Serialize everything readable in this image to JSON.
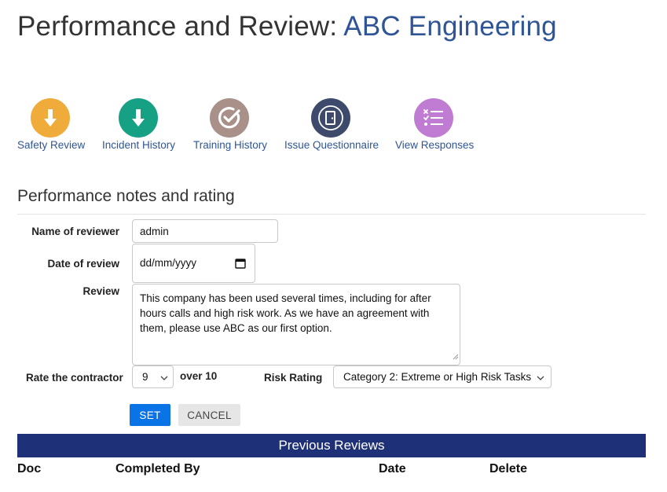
{
  "header": {
    "title_prefix": "Performance and Review:",
    "company": "ABC Engineering"
  },
  "actions": [
    {
      "label": "Safety Review",
      "icon": "arrow-down-icon",
      "color": "#f0ac3b"
    },
    {
      "label": "Incident History",
      "icon": "arrow-down-icon",
      "color": "#17a184"
    },
    {
      "label": "Training History",
      "icon": "check-circle-icon",
      "color": "#a99189"
    },
    {
      "label": "Issue Questionnaire",
      "icon": "door-icon",
      "color": "#3d4a6c"
    },
    {
      "label": "View Responses",
      "icon": "checklist-icon",
      "color": "#c07bd3"
    }
  ],
  "section": {
    "title": "Performance notes and rating"
  },
  "form": {
    "reviewer_label": "Name of reviewer",
    "reviewer_value": "admin",
    "date_label": "Date of review",
    "date_placeholder": "dd/mm/yyyy",
    "review_label": "Review",
    "review_text": "This company has been used several times, including for after hours calls and high risk work. As we have an agreement with them, please use ABC as our first option.",
    "rate_label": "Rate the contractor",
    "rate_value": "9",
    "over_label": "over 10",
    "risk_label": "Risk Rating",
    "risk_value": "Category 2: Extreme or High Risk Tasks",
    "set_label": "SET",
    "cancel_label": "CANCEL"
  },
  "previous_reviews": {
    "title": "Previous Reviews",
    "columns": [
      "Doc",
      "Completed By",
      "Date",
      "Delete"
    ]
  },
  "colors": {
    "accent": "#2f5597",
    "header_bar": "#1e3077",
    "primary_button": "#0a74e6"
  }
}
